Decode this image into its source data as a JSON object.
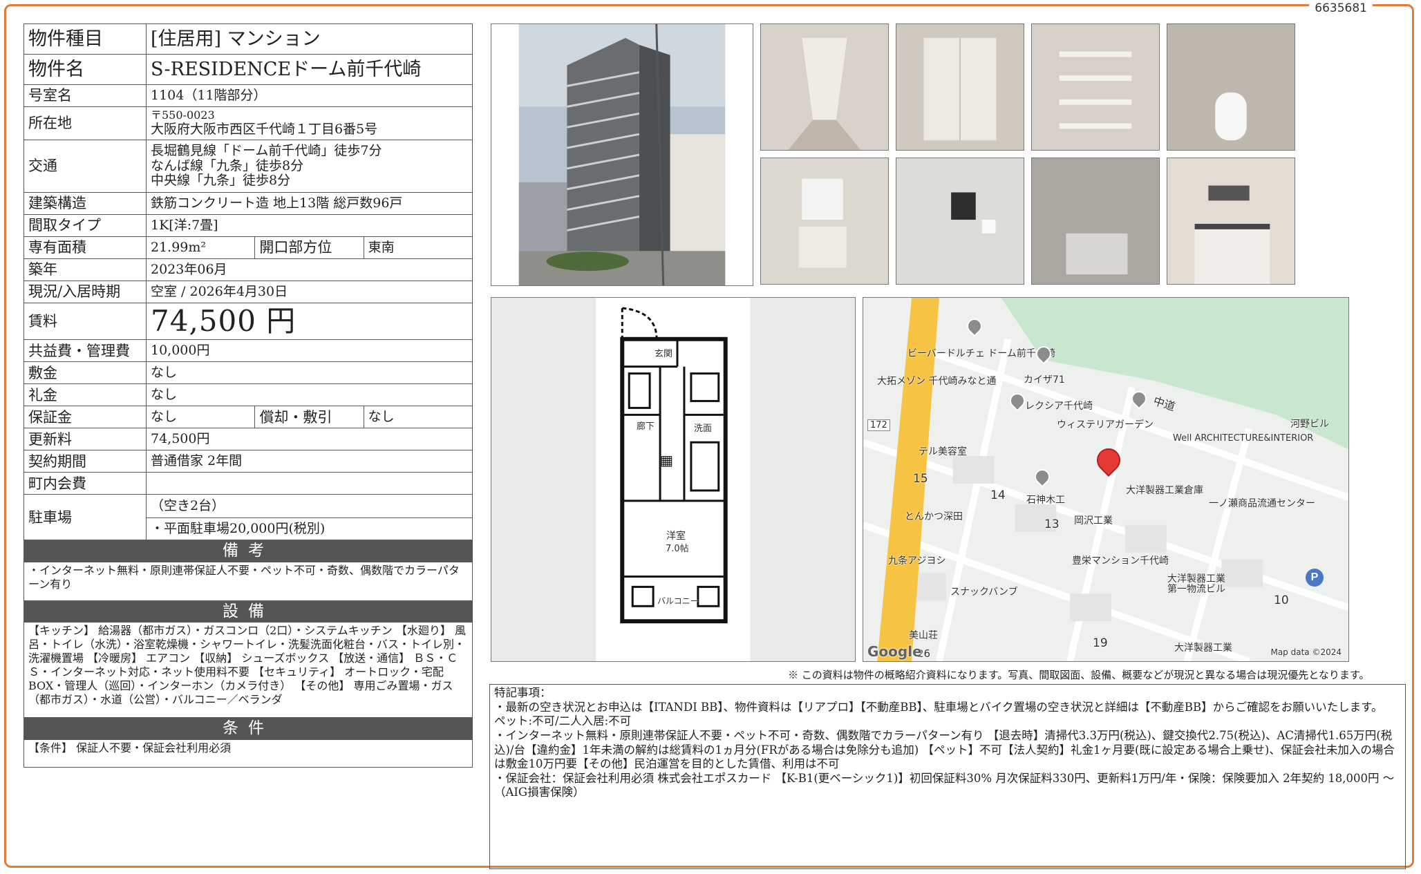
{
  "doc_id": "6635681",
  "property": {
    "type_label": "物件種目",
    "type_value": "[住居用] マンション",
    "name_label": "物件名",
    "name_value": "S-RESIDENCEドーム前千代崎",
    "room_label": "号室名",
    "room_value": "1104（11階部分）",
    "address_label": "所在地",
    "postal": "〒550-0023",
    "address": "大阪府大阪市西区千代崎１丁目6番5号",
    "transport_label": "交通",
    "transport_lines": [
      "長堀鶴見線「ドーム前千代崎」徒歩7分",
      "なんば線「九条」徒歩8分",
      "中央線「九条」徒歩8分"
    ],
    "structure_label": "建築構造",
    "structure_value": "鉄筋コンクリート造 地上13階 総戸数96戸",
    "layout_label": "間取タイプ",
    "layout_value": "1K[洋:7畳]",
    "area_label": "専有面積",
    "area_value": "21.99m²",
    "direction_label": "開口部方位",
    "direction_value": "東南",
    "built_label": "築年",
    "built_value": "2023年06月",
    "status_label": "現況/入居時期",
    "status_value": "空室 / 2026年4月30日",
    "rent_label": "賃料",
    "rent_value": "74,500 円",
    "fee_label": "共益費・管理費",
    "fee_value": "10,000円",
    "deposit_label": "敷金",
    "deposit_value": "なし",
    "key_money_label": "礼金",
    "key_money_value": "なし",
    "guarantee_label": "保証金",
    "guarantee_value": "なし",
    "amortize_label": "償却・敷引",
    "amortize_value": "なし",
    "renewal_label": "更新料",
    "renewal_value": "74,500円",
    "contract_label": "契約期間",
    "contract_value": "普通借家 2年間",
    "assoc_label": "町内会費",
    "assoc_value": "",
    "parking_label": "駐車場",
    "parking_line1": "（空き2台）",
    "parking_line2": "・平面駐車場20,000円(税別)"
  },
  "bikou": {
    "header": "備考",
    "text": "・インターネット無料・原則連帯保証人不要・ペット不可・奇数、偶数階でカラーパターン有り"
  },
  "setsubi": {
    "header": "設備",
    "text": "【キッチン】 給湯器（都市ガス）・ガスコンロ（2口）・システムキッチン 【水廻り】 風呂・トイレ（水洗）・浴室乾燥機・シャワートイレ・洗髪洗面化粧台・バス・トイレ別・洗濯機置場 【冷暖房】 エアコン 【収納】 シューズボックス 【放送・通信】 ＢＳ・ＣＳ・インターネット対応・ネット使用料不要 【セキュリティ】 オートロック・宅配BOX・管理人（巡回）・インターホン（カメラ付き） 【その他】 専用ごみ置場・ガス（都市ガス）・水道（公営）・バルコニー／ベランダ"
  },
  "jouken": {
    "header": "条件",
    "text": "【条件】 保証人不要・保証会社利用必須"
  },
  "floorplan": {
    "genkan": "玄関",
    "rouka": "廊下",
    "senmen": "洗面",
    "youshitsu": "洋室",
    "size": "7.0帖",
    "balcony": "バルコニー"
  },
  "map": {
    "road": "中道",
    "route": "172",
    "labels": [
      "ビーバードルチェ ドーム前千代崎",
      "大拓メゾン 千代崎みなと通",
      "カイザ71",
      "レクシア千代崎",
      "ウィステリアガーデン",
      "テル美容室",
      "石神木工",
      "岡沢工業",
      "大洋製器工業倉庫",
      "一ノ瀬商品流通センター",
      "とんかつ深田",
      "九条アジヨシ",
      "豊栄マンション千代崎",
      "大洋製器工業 第一物流ビル",
      "スナックバンブ",
      "美山荘",
      "大洋製器工業",
      "河野ビル",
      "Well ARCHITECTURE&INTERIOR"
    ],
    "numbers": [
      "15",
      "14",
      "13",
      "10",
      "19",
      "26"
    ],
    "google": "Google",
    "credit": "Map data ©2024"
  },
  "disclaimer": "※ この資料は物件の概略紹介資料になります。写真、間取図面、設備、概要などが現況と異なる場合は現況優先となります。",
  "remarks": "特記事項：\n・最新の空き状況とお申込は【ITANDI BB】、物件資料は【リアプロ】【不動産BB】、駐車場とバイク置場の空き状況と詳細は【不動産BB】からご確認をお願いいたします。\nペット:不可/二人入居:不可\n・インターネット無料・原則連帯保証人不要・ペット不可・奇数、偶数階でカラーパターン有り 【退去時】清掃代3.3万円(税込)、鍵交換代2.75(税込)、AC清掃代1.65万円(税込)/台【違約金】1年未満の解約は総賃料の1ヵ月分(FRがある場合は免除分も追加) 【ペット】不可【法人契約】礼金1ヶ月要(既に設定ある場合上乗せ)、保証会社未加入の場合は敷金10万円要【その他】民泊運営を目的とした賃借、利用は不可\n・保証会社：保証会社利用必須 株式会社エポスカード 【K-B1(更ベーシック1)】初回保証料30% 月次保証料330円、更新料1万円/年・保険：保険要加入 2年契約 18,000円 〜 （AIG損害保険）"
}
